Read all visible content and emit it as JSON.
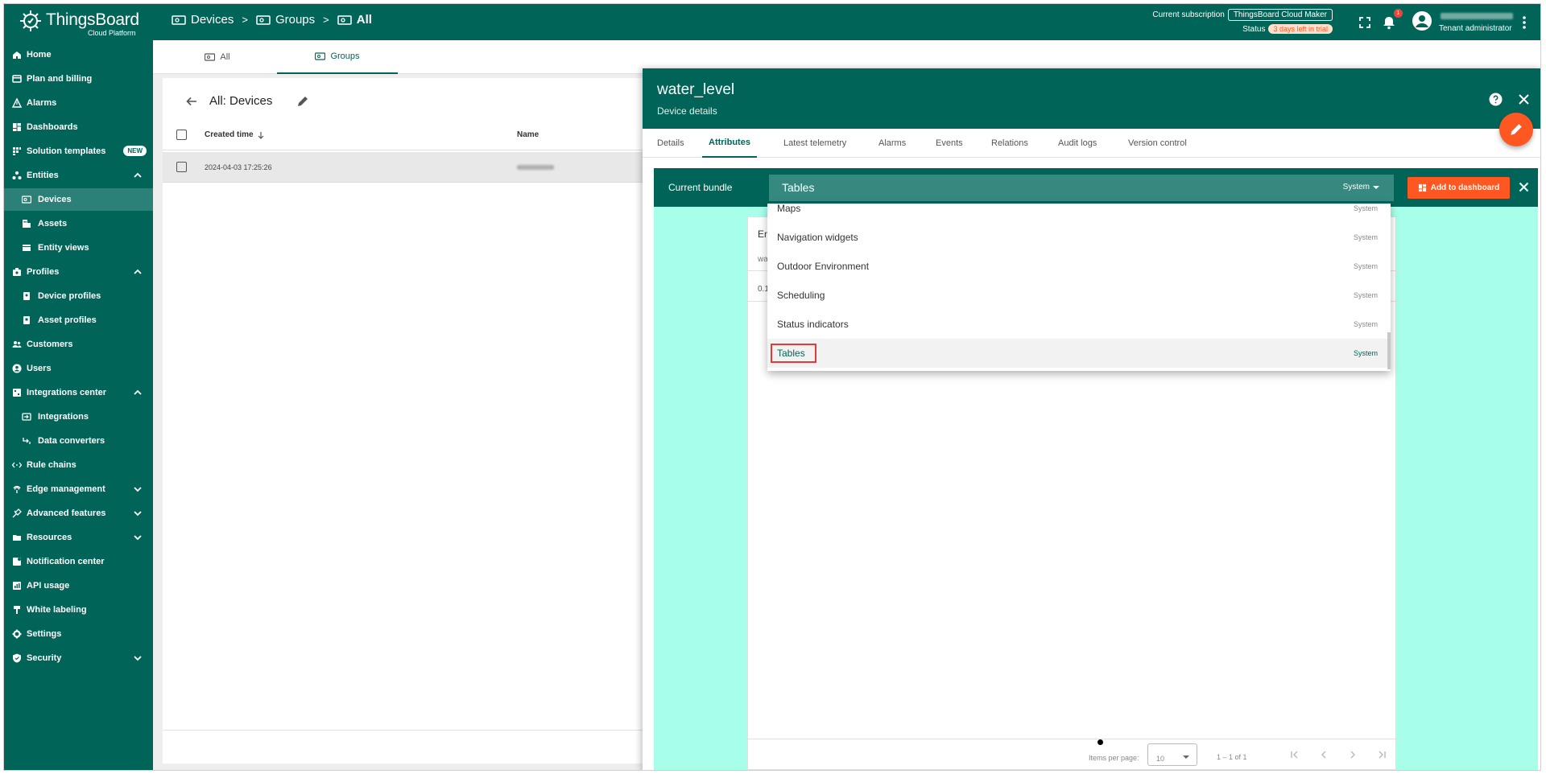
{
  "app": {
    "logo_title": "ThingsBoard",
    "logo_subtitle": "Cloud Platform"
  },
  "breadcrumb": {
    "devices": "Devices",
    "sep1": ">",
    "groups": "Groups",
    "sep2": ">",
    "all": "All"
  },
  "subscription": {
    "label": "Current subscription",
    "plan": "ThingsBoard Cloud Maker",
    "status_label": "Status",
    "status_value": "3 days left in trial"
  },
  "notifications": {
    "count": "1"
  },
  "user": {
    "role": "Tenant administrator"
  },
  "sidebar": {
    "items": [
      {
        "label": "Home",
        "icon": "home-icon"
      },
      {
        "label": "Plan and billing",
        "icon": "billing-icon"
      },
      {
        "label": "Alarms",
        "icon": "alarm-icon"
      },
      {
        "label": "Dashboards",
        "icon": "dashboards-icon"
      },
      {
        "label": "Solution templates",
        "icon": "templates-icon",
        "badge": "NEW"
      },
      {
        "label": "Entities",
        "icon": "entities-icon"
      },
      {
        "label": "Devices",
        "icon": "devices-icon"
      },
      {
        "label": "Assets",
        "icon": "assets-icon"
      },
      {
        "label": "Entity views",
        "icon": "entity-views-icon"
      },
      {
        "label": "Profiles",
        "icon": "profiles-icon"
      },
      {
        "label": "Device profiles",
        "icon": "device-profiles-icon"
      },
      {
        "label": "Asset profiles",
        "icon": "asset-profiles-icon"
      },
      {
        "label": "Customers",
        "icon": "customers-icon"
      },
      {
        "label": "Users",
        "icon": "users-icon"
      },
      {
        "label": "Integrations center",
        "icon": "integrations-center-icon"
      },
      {
        "label": "Integrations",
        "icon": "integrations-icon"
      },
      {
        "label": "Data converters",
        "icon": "data-converters-icon"
      },
      {
        "label": "Rule chains",
        "icon": "rule-chains-icon"
      },
      {
        "label": "Edge management",
        "icon": "edge-icon"
      },
      {
        "label": "Advanced features",
        "icon": "advanced-icon"
      },
      {
        "label": "Resources",
        "icon": "resources-icon"
      },
      {
        "label": "Notification center",
        "icon": "notification-center-icon"
      },
      {
        "label": "API usage",
        "icon": "api-usage-icon"
      },
      {
        "label": "White labeling",
        "icon": "white-labeling-icon"
      },
      {
        "label": "Settings",
        "icon": "settings-icon"
      },
      {
        "label": "Security",
        "icon": "security-icon"
      }
    ]
  },
  "main_tabs": {
    "all": "All",
    "groups": "Groups"
  },
  "device_list": {
    "title": "All: Devices",
    "col_created": "Created time",
    "col_name": "Name",
    "row_created": "2024-04-03 17:25:26"
  },
  "details": {
    "title": "water_level",
    "subtitle": "Device details",
    "tabs": {
      "details": "Details",
      "attributes": "Attributes",
      "latest_telemetry": "Latest telemetry",
      "alarms": "Alarms",
      "events": "Events",
      "relations": "Relations",
      "audit_logs": "Audit logs",
      "version_control": "Version control"
    }
  },
  "bundle": {
    "label": "Current bundle",
    "selected": "Tables",
    "scope": "System",
    "add_button": "Add to dashboard"
  },
  "widget": {
    "header": "En",
    "row1": "wa",
    "row2": "0.1",
    "items_per_page_label": "Items per page:",
    "items_per_page": "10",
    "range": "1 – 1 of 1"
  },
  "dropdown": {
    "items": [
      {
        "label": "Maps",
        "scope": "System"
      },
      {
        "label": "Navigation widgets",
        "scope": "System"
      },
      {
        "label": "Outdoor Environment",
        "scope": "System"
      },
      {
        "label": "Scheduling",
        "scope": "System"
      },
      {
        "label": "Status indicators",
        "scope": "System"
      },
      {
        "label": "Tables",
        "scope": "System"
      }
    ]
  },
  "colors": {
    "primary": "#006558",
    "accent": "#ff5722",
    "widget_bg": "#a7ffe9"
  }
}
